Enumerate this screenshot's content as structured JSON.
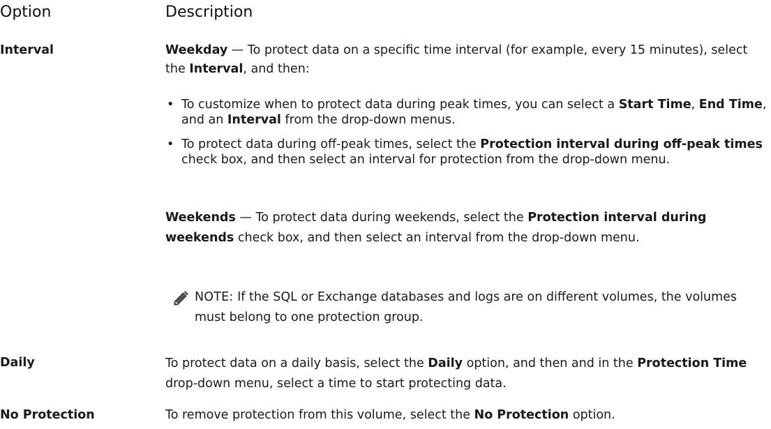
{
  "header": {
    "option": "Option",
    "description": "Description"
  },
  "rows": {
    "interval": {
      "label": "Interval",
      "weekday_title": "Weekday",
      "weekday_intro_1": " — To protect data on a specific time interval (for example, every 15 minutes), select the ",
      "weekday_intro_bold": "Interval",
      "weekday_intro_2": ", and then:",
      "bullet1_a": "To customize when to protect data during peak times, you can select a ",
      "bullet1_b1": "Start Time",
      "bullet1_c": ", ",
      "bullet1_b2": "End Time",
      "bullet1_d": ", and an ",
      "bullet1_b3": "Interval",
      "bullet1_e": " from the drop-down menus.",
      "bullet2_a": "To protect data during off-peak times, select the ",
      "bullet2_b": "Protection interval during off-peak times",
      "bullet2_c": " check box, and then select an interval for protection from the drop-down menu.",
      "weekends_title": "Weekends",
      "weekends_a": " — To protect data during weekends, select the ",
      "weekends_b": "Protection interval during weekends",
      "weekends_c": " check box, and then select an interval from the drop-down menu.",
      "note_head": "NOTE:",
      "note_text": " If the SQL or Exchange databases and logs are on different volumes, the volumes must belong to one protection group."
    },
    "daily": {
      "label": "Daily",
      "text_a": "To protect data on a daily basis, select the ",
      "text_b": "Daily",
      "text_c": " option, and then and in the ",
      "text_d": "Protection Time",
      "text_e": " drop-down menu, select a time to start protecting data."
    },
    "no_protection": {
      "label": "No Protection",
      "text_a": "To remove protection from this volume, select the ",
      "text_b": "No Protection",
      "text_c": " option."
    }
  },
  "icons": {
    "note": "pencil-icon"
  }
}
